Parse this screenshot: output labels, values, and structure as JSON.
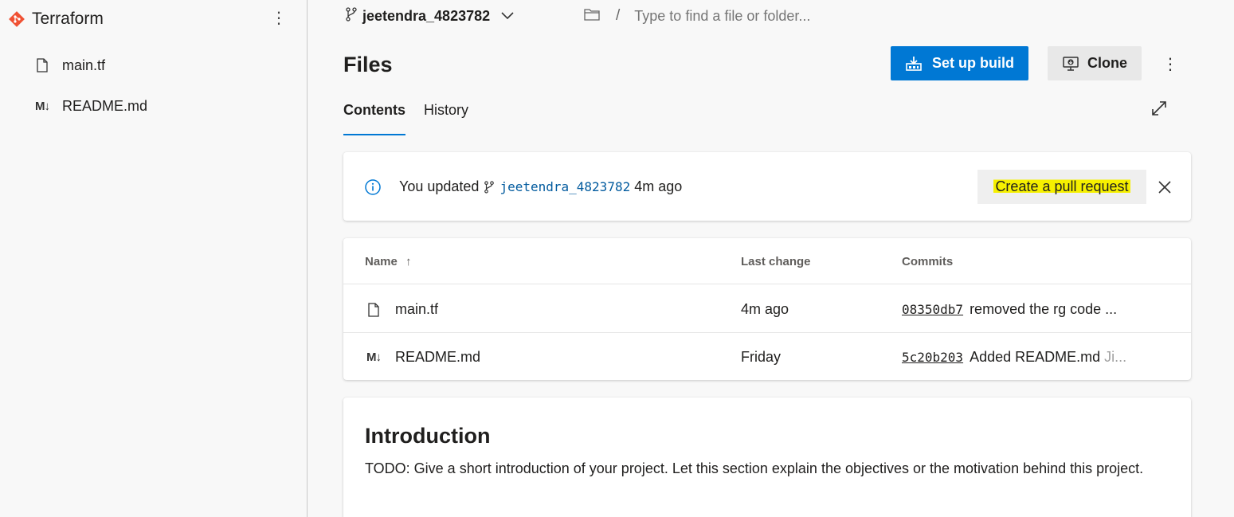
{
  "sidebar": {
    "repo_name": "Terraform",
    "more_label": "⋮",
    "files": [
      {
        "name": "main.tf",
        "icon": "file-icon"
      },
      {
        "name": "README.md",
        "icon": "markdown-icon"
      }
    ],
    "md_glyph": "M↓"
  },
  "toolbar": {
    "branch": "jeetendra_4823782",
    "path_separator": "/",
    "path_placeholder": "Type to find a file or folder..."
  },
  "header": {
    "title": "Files",
    "setup_build_label": "Set up build",
    "clone_label": "Clone",
    "more_label": "⋮"
  },
  "tabs": [
    {
      "label": "Contents",
      "active": true
    },
    {
      "label": "History",
      "active": false
    }
  ],
  "banner": {
    "prefix": "You updated",
    "branch": "jeetendra_4823782",
    "time": "4m ago",
    "action_label": "Create a pull request"
  },
  "table": {
    "columns": {
      "name": "Name",
      "sort_indicator": "↑",
      "last_change": "Last change",
      "commits": "Commits"
    },
    "rows": [
      {
        "name": "main.tf",
        "icon": "file-icon",
        "last_change": "4m ago",
        "commit_hash": "08350db7",
        "commit_msg": "removed the rg code ...",
        "commit_author": ""
      },
      {
        "name": "README.md",
        "icon": "markdown-icon",
        "last_change": "Friday",
        "commit_hash": "5c20b203",
        "commit_msg": "Added README.md",
        "commit_author": "Ji..."
      }
    ]
  },
  "readme": {
    "heading": "Introduction",
    "body": "TODO: Give a short introduction of your project. Let this section explain the objectives or the motivation behind this project."
  },
  "colors": {
    "accent": "#0078d4",
    "git_brand": "#f05133",
    "highlight": "#f6f000",
    "link": "#005a9e"
  }
}
